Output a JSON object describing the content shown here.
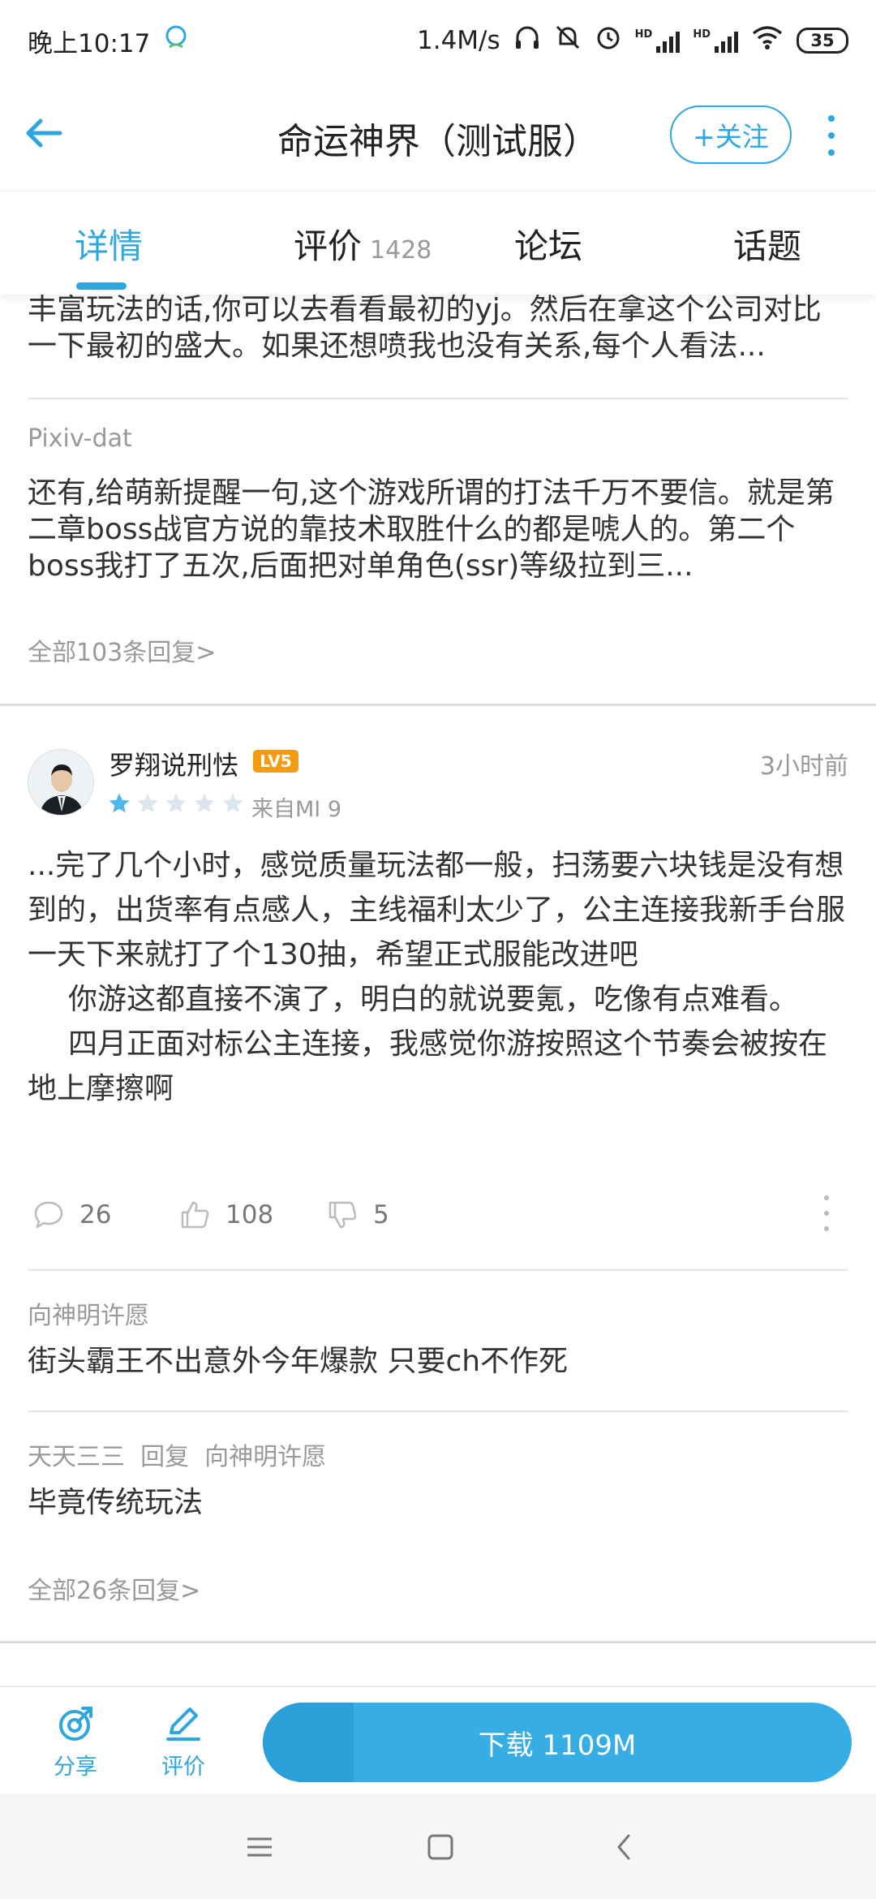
{
  "status_bar": {
    "time": "晚上10:17",
    "speed": "1.4M/s",
    "hd1": "HD",
    "hd2": "HD",
    "battery": "35"
  },
  "app_bar": {
    "title": "命运神界（测试服）",
    "follow_label": "+关注",
    "accent_color": "#2ea6de"
  },
  "tabs": [
    {
      "label": "详情",
      "active": true
    },
    {
      "label": "评价",
      "count": "1428"
    },
    {
      "label": "论坛"
    },
    {
      "label": "话题"
    }
  ],
  "prev_review": {
    "tail_text": "丰富玩法的话,你可以去看看最初的yj。然后在拿这个公司对比一下最初的盛大。如果还想喷我也没有关系,每个人看法...",
    "reply": {
      "user": "Pixiv-dat",
      "text": "还有,给萌新提醒一句,这个游戏所谓的打法千万不要信。就是第二章boss战官方说的靠技术取胜什么的都是唬人的。第二个boss我打了五次,后面把对单角色(ssr)等级拉到三..."
    },
    "all_replies": "全部103条回复>"
  },
  "review": {
    "user": "罗翔说刑怯",
    "level": "LV5",
    "time": "3小时前",
    "rating": 1,
    "device": "来自MI 9",
    "paragraph1": "...完了几个小时，感觉质量玩法都一般，扫荡要六块钱是没有想到的，出货率有点感人，主线福利太少了，公主连接我新手台服一天下来就打了个130抽，希望正式服能改进吧",
    "paragraph2": "你游这都直接不演了，明白的就说要氪，吃像有点难看。",
    "paragraph3": "四月正面对标公主连接，我感觉你游按照这个节奏会被按在地上摩擦啊",
    "comments": "26",
    "likes": "108",
    "dislikes": "5",
    "replies": [
      {
        "user": "向神明许愿",
        "text": "街头霸王不出意外今年爆款  只要ch不作死"
      },
      {
        "user": "天天三三",
        "reply_word": "回复",
        "reply_to": "向神明许愿",
        "text": "毕竟传统玩法"
      }
    ],
    "all_replies": "全部26条回复>"
  },
  "bottom_bar": {
    "share_label": "分享",
    "rate_label": "评价",
    "download_label": "下载 1109M"
  }
}
